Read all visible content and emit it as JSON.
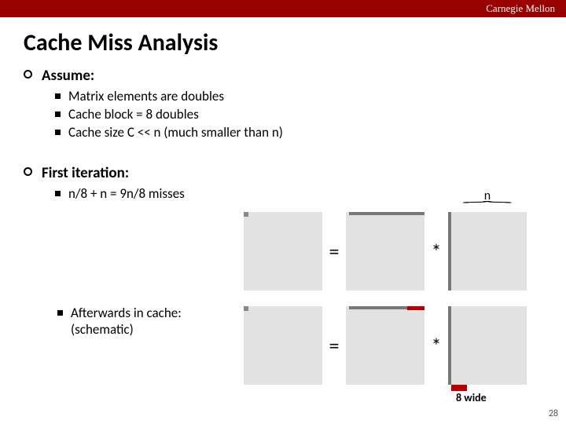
{
  "header": {
    "org": "Carnegie Mellon"
  },
  "title": "Cache Miss Analysis",
  "assume": {
    "label": "Assume:",
    "items": [
      "Matrix elements are doubles",
      "Cache block = 8 doubles",
      "Cache size C << n (much smaller than n)"
    ]
  },
  "first_iter": {
    "label": "First iteration:",
    "misses": "n/8 + n = 9n/8 misses",
    "afterwards_line1": "Afterwards in cache:",
    "afterwards_line2": "(schematic)"
  },
  "diagram": {
    "n_label": "n",
    "eq": "=",
    "mult": "*",
    "wide_label": "8 wide"
  },
  "page": "28"
}
